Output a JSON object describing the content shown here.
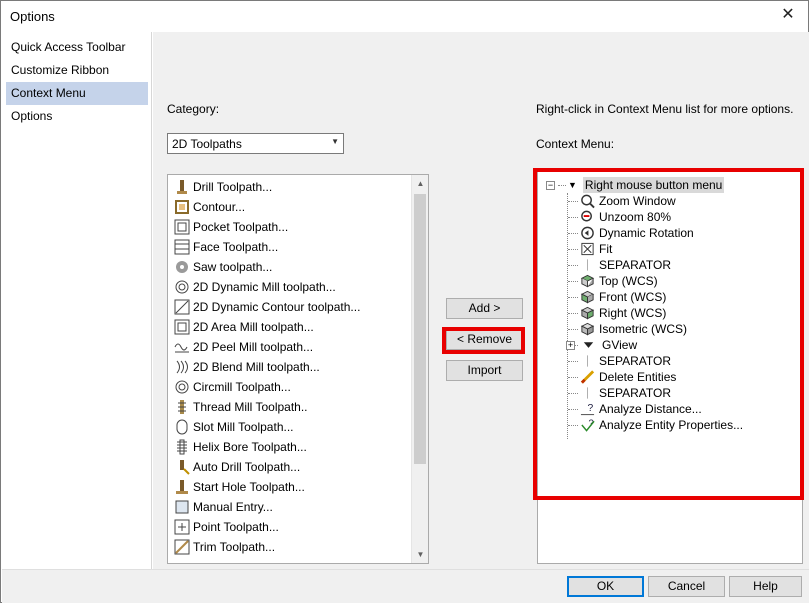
{
  "window": {
    "title": "Options",
    "close_glyph": "✕"
  },
  "nav": {
    "items": [
      {
        "label": "Quick Access Toolbar"
      },
      {
        "label": "Customize Ribbon"
      },
      {
        "label": "Context Menu"
      },
      {
        "label": "Options"
      }
    ],
    "selected": "Context Menu"
  },
  "category": {
    "label": "Category:",
    "value": "2D Toolpaths"
  },
  "toolpaths": [
    {
      "label": "Drill Toolpath...",
      "icon": "drill-icon"
    },
    {
      "label": "Contour...",
      "icon": "contour-icon"
    },
    {
      "label": "Pocket Toolpath...",
      "icon": "pocket-icon"
    },
    {
      "label": "Face Toolpath...",
      "icon": "face-icon"
    },
    {
      "label": "Saw toolpath...",
      "icon": "saw-icon"
    },
    {
      "label": "2D Dynamic Mill toolpath...",
      "icon": "dynamic-mill-icon"
    },
    {
      "label": "2D Dynamic Contour toolpath...",
      "icon": "dynamic-contour-icon"
    },
    {
      "label": "2D Area Mill toolpath...",
      "icon": "area-mill-icon"
    },
    {
      "label": "2D Peel Mill toolpath...",
      "icon": "peel-mill-icon"
    },
    {
      "label": "2D Blend Mill toolpath...",
      "icon": "blend-mill-icon"
    },
    {
      "label": "Circmill Toolpath...",
      "icon": "circmill-icon"
    },
    {
      "label": "Thread Mill Toolpath..",
      "icon": "thread-mill-icon"
    },
    {
      "label": "Slot Mill Toolpath...",
      "icon": "slot-mill-icon"
    },
    {
      "label": "Helix Bore Toolpath...",
      "icon": "helix-bore-icon"
    },
    {
      "label": "Auto Drill Toolpath...",
      "icon": "auto-drill-icon"
    },
    {
      "label": "Start Hole Toolpath...",
      "icon": "start-hole-icon"
    },
    {
      "label": "Manual Entry...",
      "icon": "manual-entry-icon"
    },
    {
      "label": "Point Toolpath...",
      "icon": "point-icon"
    },
    {
      "label": "Trim Toolpath...",
      "icon": "trim-icon"
    }
  ],
  "buttons": {
    "add": "Add >",
    "remove": "< Remove",
    "import": "Import"
  },
  "context_menu": {
    "hint": "Right-click in Context Menu list for more options.",
    "label": "Context Menu:",
    "root": "Right mouse button menu",
    "items": [
      {
        "label": "Zoom Window",
        "icon": "zoom-window-icon"
      },
      {
        "label": "Unzoom 80%",
        "icon": "unzoom-icon"
      },
      {
        "label": "Dynamic Rotation",
        "icon": "dynamic-rotation-icon"
      },
      {
        "label": "Fit",
        "icon": "fit-icon"
      },
      {
        "label": "SEPARATOR",
        "icon": ""
      },
      {
        "label": "Top (WCS)",
        "icon": "top-view-icon"
      },
      {
        "label": "Front (WCS)",
        "icon": "front-view-icon"
      },
      {
        "label": "Right (WCS)",
        "icon": "right-view-icon"
      },
      {
        "label": "Isometric (WCS)",
        "icon": "isometric-view-icon"
      },
      {
        "label": "GView",
        "icon": "submenu-arrow-icon"
      },
      {
        "label": "SEPARATOR",
        "icon": ""
      },
      {
        "label": "Delete Entities",
        "icon": "delete-entities-icon"
      },
      {
        "label": "SEPARATOR",
        "icon": ""
      },
      {
        "label": "Analyze Distance...",
        "icon": "analyze-distance-icon"
      },
      {
        "label": "Analyze Entity Properties...",
        "icon": "analyze-entity-icon"
      }
    ]
  },
  "footer": {
    "ok": "OK",
    "cancel": "Cancel",
    "help": "Help"
  },
  "colors": {
    "highlight": "#e80000",
    "nav_selected": "#c5d3ea",
    "accent": "#0078d7"
  }
}
